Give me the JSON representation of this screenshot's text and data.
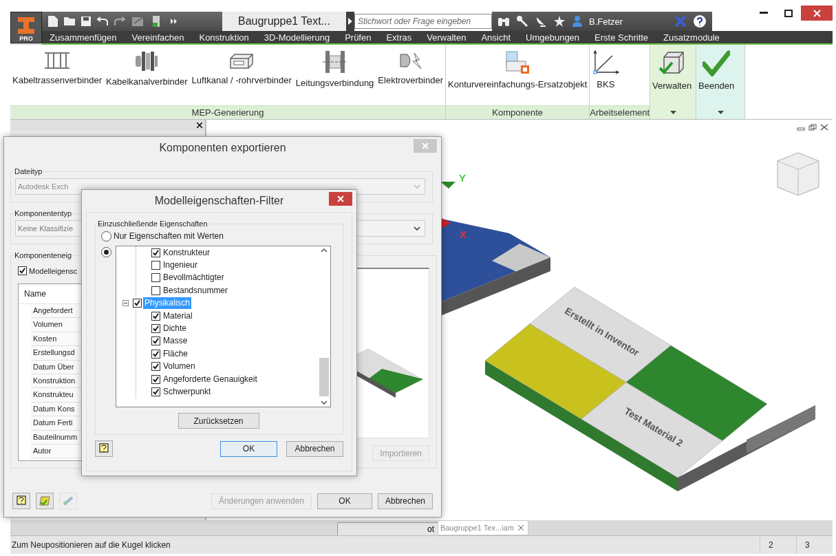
{
  "app": {
    "badge": "PRO",
    "title": "Baugruppe1 Text...",
    "search": {
      "placeholder": "Stichwort oder Frage eingeben"
    },
    "user": "B.Fetzer"
  },
  "menu": [
    "Zusammenfügen",
    "Vereinfachen",
    "Konstruktion",
    "3D-Modellierung",
    "Prüfen",
    "Extras",
    "Verwalten",
    "Ansicht",
    "Umgebungen",
    "Erste Schritte",
    "Zusatzmodule"
  ],
  "ribbon": [
    {
      "kind": "panel",
      "title": "MEP-Generierung",
      "tools": [
        {
          "label": "Kabeltrassenverbinder"
        },
        {
          "label": "Kabelkanalverbinder"
        },
        {
          "label": "Luftkanal / -rohrverbinder"
        },
        {
          "label": "Leitungsverbindung"
        },
        {
          "label": "Elektroverbinder"
        }
      ]
    },
    {
      "kind": "panel",
      "title": "Komponente",
      "tools": [
        {
          "label": "Konturvereinfachungs-Ersatzobjekt"
        }
      ]
    },
    {
      "kind": "panel",
      "title": "Arbeitselement",
      "tools": [
        {
          "label": "BKS"
        }
      ]
    },
    {
      "kind": "action",
      "tools": [
        {
          "label": "Verwalten"
        }
      ]
    },
    {
      "kind": "action",
      "tools": [
        {
          "label": "Beenden"
        }
      ]
    }
  ],
  "viewport": {
    "axis_labels": [
      "Y",
      "X"
    ],
    "model_labels": [
      "Erstellt in Inventor",
      "Test Material 2"
    ]
  },
  "export_dialog": {
    "title": "Komponenten exportieren",
    "file_type": {
      "legend": "Dateityp",
      "value": "Autodesk Exch"
    },
    "component_type": {
      "legend": "Komponententyp",
      "value": "Keine Klassifizie"
    },
    "properties": {
      "legend": "Komponenteneig",
      "checkbox": {
        "label": "Modelleigensc",
        "checked": true
      },
      "column": "Name",
      "rows": [
        "Angefordert",
        "Volumen",
        "Kosten",
        "Erstellungsd",
        "Datum Über",
        "Konstruktion",
        "Konstrukteu",
        "Datum Kons",
        "Datum Ferti",
        "Bauteilnumm",
        "Autor"
      ],
      "import_button": {
        "label": "Importieren",
        "disabled": true
      }
    },
    "buttons": [
      {
        "label": "Änderungen anwenden",
        "disabled": true
      },
      {
        "label": "OK",
        "disabled": false
      },
      {
        "label": "Abbrechen",
        "disabled": false
      }
    ]
  },
  "filter_dialog": {
    "title": "Modelleigenschaften-Filter",
    "group": "Einzuschließende Eigenschaften",
    "options": [
      {
        "label": "Nur Eigenschaften mit Werten",
        "selected": false
      },
      {
        "selected": true
      }
    ],
    "tree": [
      {
        "children": [
          {
            "label": "Konstrukteur",
            "checked": true,
            "selected": false
          },
          {
            "label": "Ingenieur",
            "checked": false,
            "selected": false
          },
          {
            "label": "Bevollmächtigter",
            "checked": false,
            "selected": false
          },
          {
            "label": "Bestandsnummer",
            "checked": false,
            "selected": false
          }
        ]
      },
      {
        "label": "Physikalisch",
        "checked": true,
        "expanded": true,
        "selected": true,
        "children": [
          {
            "label": "Material",
            "checked": true,
            "selected": false
          },
          {
            "label": "Dichte",
            "checked": true,
            "selected": false
          },
          {
            "label": "Masse",
            "checked": true,
            "selected": false
          },
          {
            "label": "Fläche",
            "checked": true,
            "selected": false
          },
          {
            "label": "Volumen",
            "checked": true,
            "selected": false
          },
          {
            "label": "Angeforderte Genauigkeit",
            "checked": true,
            "selected": false
          },
          {
            "label": "Schwerpunkt",
            "checked": true,
            "selected": false
          }
        ]
      }
    ],
    "reset_button": "Zurücksetzen",
    "buttons": [
      {
        "label": "OK",
        "default": true
      },
      {
        "label": "Abbrechen",
        "default": false
      }
    ]
  },
  "document_tabs": [
    {
      "label": "ot",
      "selected": false
    },
    {
      "label": "Baugruppe1 Tex...iam",
      "selected": true
    }
  ],
  "status_bar": {
    "message": "Zum Neupositionieren auf die Kugel klicken",
    "cells": [
      "2",
      "3"
    ]
  }
}
